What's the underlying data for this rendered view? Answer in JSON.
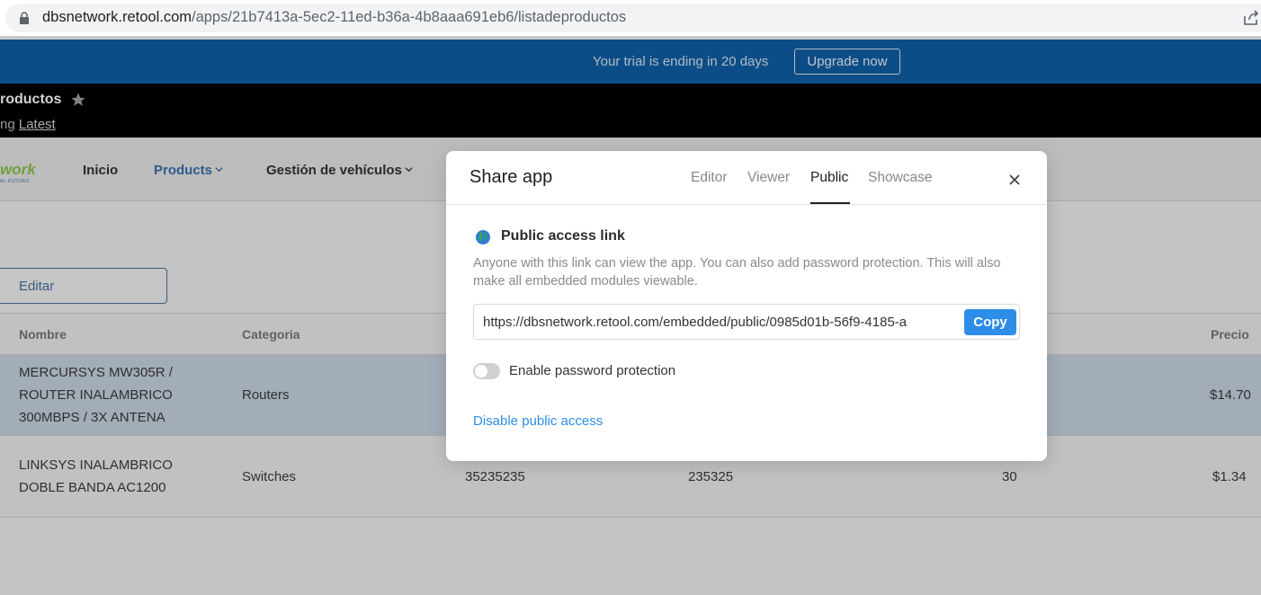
{
  "browser": {
    "url_host": "dbsnetwork.retool.com",
    "url_path": "/apps/21b7413a-5ec2-11ed-b36a-4b8aaa691eb6/listadeproductos"
  },
  "banner": {
    "text": "Your trial is ending in 20 days",
    "upgrade_label": "Upgrade now"
  },
  "app_header": {
    "title": "roductos",
    "subline_prefix": "ng ",
    "latest_label": "Latest"
  },
  "nav": {
    "logo_text": "work",
    "logo_sub": "AL FUTURO",
    "items": [
      {
        "label": "Inicio"
      },
      {
        "label": "Products"
      },
      {
        "label": "Gestión de vehículos"
      }
    ]
  },
  "toolbar": {
    "edit_label": "Editar"
  },
  "table": {
    "headers": [
      "Nombre",
      "Categoria",
      "Precio"
    ],
    "rows": [
      {
        "name_lines": [
          "MERCURSYS MW305R /",
          "ROUTER INALAMBRICO",
          "300MBPS / 3X ANTENA"
        ],
        "category": "Routers",
        "col3": "",
        "col4": "",
        "col5": "",
        "price": "$14.70"
      },
      {
        "name_lines": [
          "LINKSYS INALAMBRICO",
          "DOBLE BANDA AC1200"
        ],
        "category": "Switches",
        "col3": "35235235",
        "col4": "235325",
        "col5": "30",
        "price": "$1.34"
      }
    ]
  },
  "modal": {
    "title": "Share app",
    "tabs": [
      {
        "label": "Editor"
      },
      {
        "label": "Viewer"
      },
      {
        "label": "Public"
      },
      {
        "label": "Showcase"
      }
    ],
    "active_tab": "Public",
    "section_title": "Public access link",
    "description": "Anyone with this link can view the app. You can also add password protection. This will also make all embedded modules viewable.",
    "link_value": "https://dbsnetwork.retool.com/embedded/public/0985d01b-56f9-4185-a",
    "copy_label": "Copy",
    "password_toggle_label": "Enable password protection",
    "password_enabled": false,
    "disable_label": "Disable public access"
  },
  "colors": {
    "banner": "#115ea5",
    "accent": "#2d8de8",
    "selected_row": "#c6d3e1"
  }
}
